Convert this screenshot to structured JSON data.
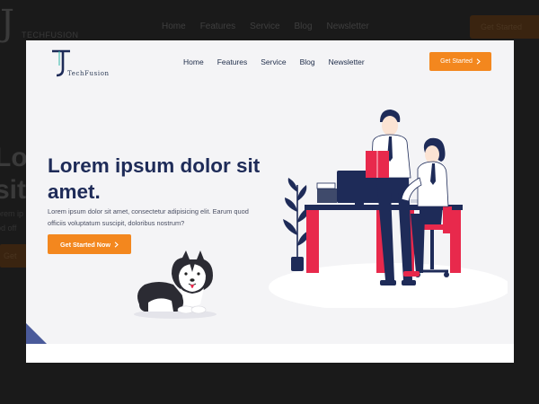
{
  "background_page": {
    "logo_mark": "J",
    "logo_text": "TECHFUSION",
    "nav": [
      "Home",
      "Features",
      "Service",
      "Blog",
      "Newsletter"
    ],
    "cta_label": "Get Started",
    "heading": "Lo\nsit",
    "paragraph": "orem ip\nod off",
    "button_label": "Get"
  },
  "brand": {
    "logo_mark": "T",
    "name": "TechFusion"
  },
  "nav": {
    "items": [
      {
        "label": "Home"
      },
      {
        "label": "Features"
      },
      {
        "label": "Service"
      },
      {
        "label": "Blog"
      },
      {
        "label": "Newsletter"
      }
    ]
  },
  "header_cta": {
    "label": "Get Started",
    "icon": "chevron-right-icon"
  },
  "hero": {
    "headline": "Lorem ipsum dolor sit amet.",
    "description": "Lorem ipsum dolor sit amet, consectetur adipisicing elit. Earum quod officiis voluptatum suscipit, doloribus nostrum?",
    "cta_label": "Get Started Now",
    "cta_icon": "chevron-right-icon"
  },
  "colors": {
    "accent": "#f3871e",
    "navy": "#1e2b58",
    "pink": "#e8294c",
    "hero_bg": "#f4f4f6",
    "overlay": "#1a1a1a"
  }
}
